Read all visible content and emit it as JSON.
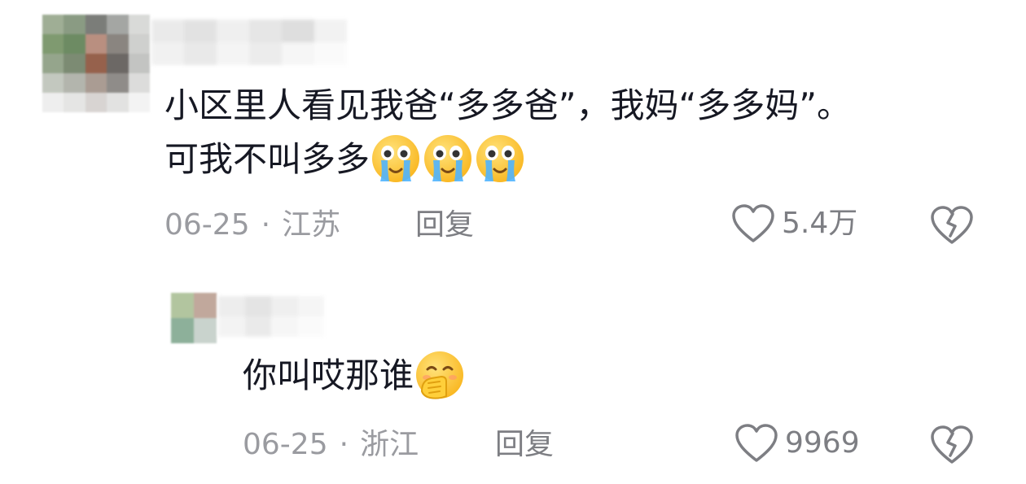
{
  "comments": [
    {
      "line1": "小区里人看见我爸“多多爸”，我妈“多多妈”。",
      "line2": "可我不叫多多",
      "emoji": "crying-face",
      "emoji_count": 3,
      "date": "06-25",
      "separator": "·",
      "location": "江苏",
      "reply_label": "回复",
      "likes": "5.4万"
    },
    {
      "line1": "你叫哎那谁",
      "emoji": "hand-over-mouth-face",
      "date": "06-25",
      "separator": "·",
      "location": "浙江",
      "reply_label": "回复",
      "likes": "9969"
    }
  ],
  "icons": {
    "like": "heart-outline-icon",
    "dislike": "broken-heart-icon"
  },
  "colors": {
    "text": "#161823",
    "meta": "#9a9ba0",
    "action": "#7d7e83",
    "emoji_yellow": "#ffc83d",
    "tears": "#4fb4ff"
  }
}
